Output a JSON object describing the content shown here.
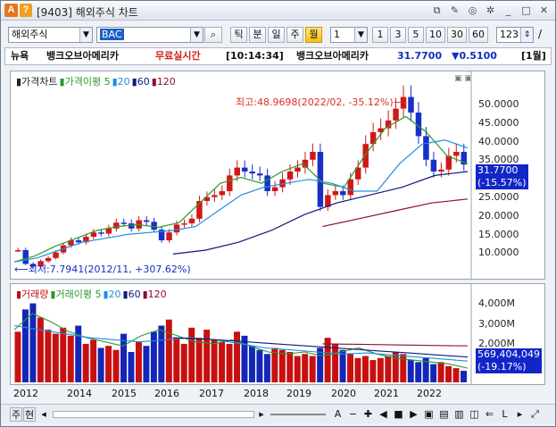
{
  "window": {
    "code_badge": "A",
    "help_badge": "?",
    "title": "[9403] 해외주식 차트",
    "controls": [
      "⧉",
      "✎",
      "◎",
      "✲",
      "_",
      "□",
      "✕"
    ]
  },
  "toolbar": {
    "market": "해외주식",
    "symbol": "BAC",
    "periods": [
      "틱",
      "분",
      "일",
      "주",
      "월"
    ],
    "active_period": "월",
    "interval": "1",
    "quick": [
      "1",
      "3",
      "5",
      "10",
      "30",
      "60"
    ],
    "count": "123",
    "slash": "/"
  },
  "ticker": {
    "exchange": "뉴욕",
    "name": "뱅크오브아메리카",
    "realtime": "무료실시간",
    "time": "[10:14:34]",
    "name2": "뱅크오브아메리카",
    "price": "31.7700",
    "change": "▼0.5100",
    "period": "[1월]"
  },
  "price_panel": {
    "legend": [
      {
        "text": "▮가격차트",
        "color": "#222222"
      },
      {
        "text": "▮가격이평 5",
        "color": "#2b9a2b"
      },
      {
        "text": "▮20",
        "color": "#1f8fe0"
      },
      {
        "text": "▮60",
        "color": "#0c1a7a"
      },
      {
        "text": "▮120",
        "color": "#8a1030"
      }
    ],
    "y_ticks": [
      "50.0000",
      "45.0000",
      "40.0000",
      "35.0000",
      "30.0000",
      "25.0000",
      "20.0000",
      "15.0000",
      "10.0000"
    ],
    "high_label": "최고:48.9698(2022/02, -35.12%)⟶",
    "low_label": "⟵최저:7.7941(2012/11, +307.62%)",
    "current_price": "31.7700",
    "current_pct": "(-15.57%)"
  },
  "volume_panel": {
    "legend": [
      {
        "text": "▮거래량",
        "color": "#c01010"
      },
      {
        "text": "▮거래이평 5",
        "color": "#2b9a2b"
      },
      {
        "text": "▮20",
        "color": "#1f8fe0"
      },
      {
        "text": "▮60",
        "color": "#0c1a7a"
      },
      {
        "text": "▮120",
        "color": "#8a1030"
      }
    ],
    "y_ticks": [
      "4,000M",
      "3,000M",
      "2,000M"
    ],
    "current_volume": "569,404,049",
    "current_pct": "(-19.17%)"
  },
  "x_ticks": [
    "2012",
    "2014",
    "2015",
    "2016",
    "2017",
    "2018",
    "2019",
    "2020",
    "2021",
    "2022"
  ],
  "bottombar": {
    "left": [
      "주",
      "현"
    ],
    "tools": [
      "A",
      "−",
      "✚",
      "◀",
      "■",
      "▶",
      "▣",
      "▤",
      "▥",
      "◫",
      "⇐",
      "L",
      "▸",
      "⤢"
    ]
  },
  "chart_data": [
    {
      "type": "candlestick",
      "title": "가격차트",
      "x_range": [
        "2011",
        "2022"
      ],
      "ylim": [
        5,
        55
      ],
      "series": [
        {
          "name": "가격",
          "values": [
            10,
            6.5,
            5.8,
            7.2,
            8.0,
            9.4,
            11.2,
            12.5,
            12.0,
            13.4,
            14.5,
            14.2,
            15.5,
            17.0,
            16.8,
            15.5,
            17.6,
            17.2,
            15.2,
            12.5,
            14.5,
            16.5,
            16.8,
            18.0,
            22.5,
            23.5,
            24.0,
            25.0,
            29.0,
            31.0,
            30.0,
            29.5,
            29.0,
            25.0,
            26.0,
            28.0,
            30.0,
            31.0,
            33.0,
            35.0,
            21.0,
            24.0,
            25.0,
            24.0,
            28.0,
            31.0,
            37.0,
            40.0,
            41.0,
            43.0,
            46.0,
            48.97,
            45.0,
            39.0,
            33.0,
            30.0,
            30.5,
            34.0,
            35.0,
            31.77
          ]
        },
        {
          "name": "가격이평 5",
          "values": [
            7.0,
            8.5,
            11.0,
            13.0,
            15.0,
            16.0,
            16.5,
            15.8,
            17.0,
            22.0,
            27.0,
            28.5,
            27.0,
            30.0,
            32.0,
            27.0,
            26.0,
            34.0,
            41.0,
            44.0,
            40.0,
            34.0,
            32.0
          ]
        },
        {
          "name": "20",
          "values": [
            7.0,
            8.0,
            10.0,
            12.0,
            13.0,
            14.0,
            14.5,
            15.0,
            16.0,
            20.0,
            24.0,
            26.0,
            27.0,
            28.0,
            27.0,
            25.0,
            25.0,
            32.0,
            37.0,
            38.0,
            36.0
          ]
        },
        {
          "name": "60",
          "values": [
            9.0,
            10.0,
            12.0,
            15.0,
            19.0,
            22.0,
            24.0,
            26.0,
            29.0,
            30.0
          ]
        },
        {
          "name": "120",
          "values": [
            16.0,
            18.0,
            20.0,
            22.0,
            23.0
          ]
        }
      ],
      "annotations": [
        {
          "label": "최고",
          "value": 48.9698,
          "date": "2022/02",
          "pct": -35.12
        },
        {
          "label": "최저",
          "value": 7.7941,
          "date": "2012/11",
          "pct": 307.62
        }
      ]
    },
    {
      "type": "bar",
      "title": "거래량",
      "ylim": [
        0,
        4500
      ],
      "ylabel": "M",
      "series": [
        {
          "name": "거래량",
          "values": [
            2500,
            3600,
            3900,
            3200,
            2600,
            2400,
            2700,
            2300,
            2800,
            1900,
            2100,
            1700,
            1800,
            1600,
            2400,
            1500,
            2000,
            1800,
            2500,
            2800,
            3100,
            2200,
            1900,
            2700,
            2200,
            2600,
            2100,
            2000,
            1900,
            2500,
            2300,
            1800,
            1600,
            1400,
            1700,
            1600,
            1500,
            1300,
            1400,
            1300,
            1700,
            2200,
            1900,
            1600,
            1400,
            1200,
            1300,
            1100,
            1200,
            1300,
            1500,
            1400,
            1100,
            1000,
            1200,
            900,
            1000,
            800,
            700,
            570
          ]
        }
      ]
    }
  ]
}
